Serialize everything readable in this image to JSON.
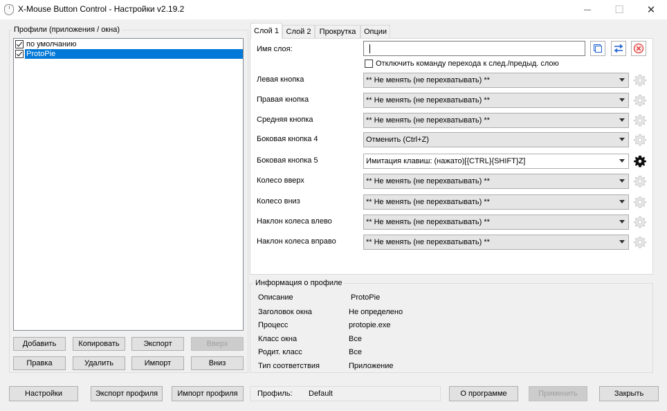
{
  "window": {
    "title": "X-Mouse Button Control - Настройки v2.19.2",
    "controls": {
      "minimize": "—",
      "maximize": "☐",
      "close": "✕"
    }
  },
  "profiles": {
    "group_label": "Профили (приложения / окна)",
    "items": [
      {
        "label": "по умолчанию",
        "checked": true,
        "selected": false
      },
      {
        "label": "ProtoPie",
        "checked": true,
        "selected": true
      }
    ],
    "buttons": {
      "add": "Добавить",
      "copy": "Копировать",
      "export": "Экспорт",
      "up": "Вверх",
      "edit": "Правка",
      "delete": "Удалить",
      "import": "Импорт",
      "down": "Вниз"
    }
  },
  "tabs": [
    "Слой 1",
    "Слой 2",
    "Прокрутка",
    "Опции"
  ],
  "layer": {
    "name_label": "Имя слоя:",
    "name_value": "",
    "disable_switch_label": "Отключить команду перехода к след./предыд. слою",
    "icons": {
      "copy": "copy-icon",
      "swap": "swap-icon",
      "clear": "clear-icon"
    }
  },
  "mappings": [
    {
      "label": "Левая кнопка",
      "value": "** Не менять (не перехватывать) **",
      "gear_active": false
    },
    {
      "label": "Правая кнопка",
      "value": "** Не менять (не перехватывать) **",
      "gear_active": false
    },
    {
      "label": "Средняя кнопка",
      "value": "** Не менять (не перехватывать) **",
      "gear_active": false
    },
    {
      "label": "Боковая кнопка 4",
      "value": "Отменить (Ctrl+Z)",
      "gear_active": false
    },
    {
      "label": "Боковая кнопка 5",
      "value": "Имитация клавиш: (нажато)[{CTRL}{SHIFT}Z]",
      "gear_active": true
    },
    {
      "label": "Колесо вверх",
      "value": "** Не менять (не перехватывать) **",
      "gear_active": false
    },
    {
      "label": "Колесо вниз",
      "value": "** Не менять (не перехватывать) **",
      "gear_active": false
    },
    {
      "label": "Наклон колеса влево",
      "value": "** Не менять (не перехватывать) **",
      "gear_active": false
    },
    {
      "label": "Наклон колеса вправо",
      "value": "** Не менять (не перехватывать) **",
      "gear_active": false
    }
  ],
  "profile_info": {
    "group_label": "Информация о профиле",
    "rows": [
      {
        "label": "Описание",
        "value": "ProtoPie"
      },
      {
        "label": "Заголовок окна",
        "value": "Не определено"
      },
      {
        "label": "Процесс",
        "value": "protopie.exe"
      },
      {
        "label": "Класс окна",
        "value": "Все"
      },
      {
        "label": "Родит. класс",
        "value": "Все"
      },
      {
        "label": "Тип соответствия",
        "value": "Приложение"
      }
    ]
  },
  "bottom": {
    "settings": "Настройки",
    "export_profile": "Экспорт профиля",
    "import_profile": "Импорт профиля",
    "profile_label": "Профиль:",
    "profile_value": "Default",
    "about": "О программе",
    "apply": "Применить",
    "close": "Закрыть"
  },
  "colors": {
    "selection": "#0078d7",
    "swap_arrows": "#1a5fd0",
    "clear_red": "#e03a3a"
  }
}
